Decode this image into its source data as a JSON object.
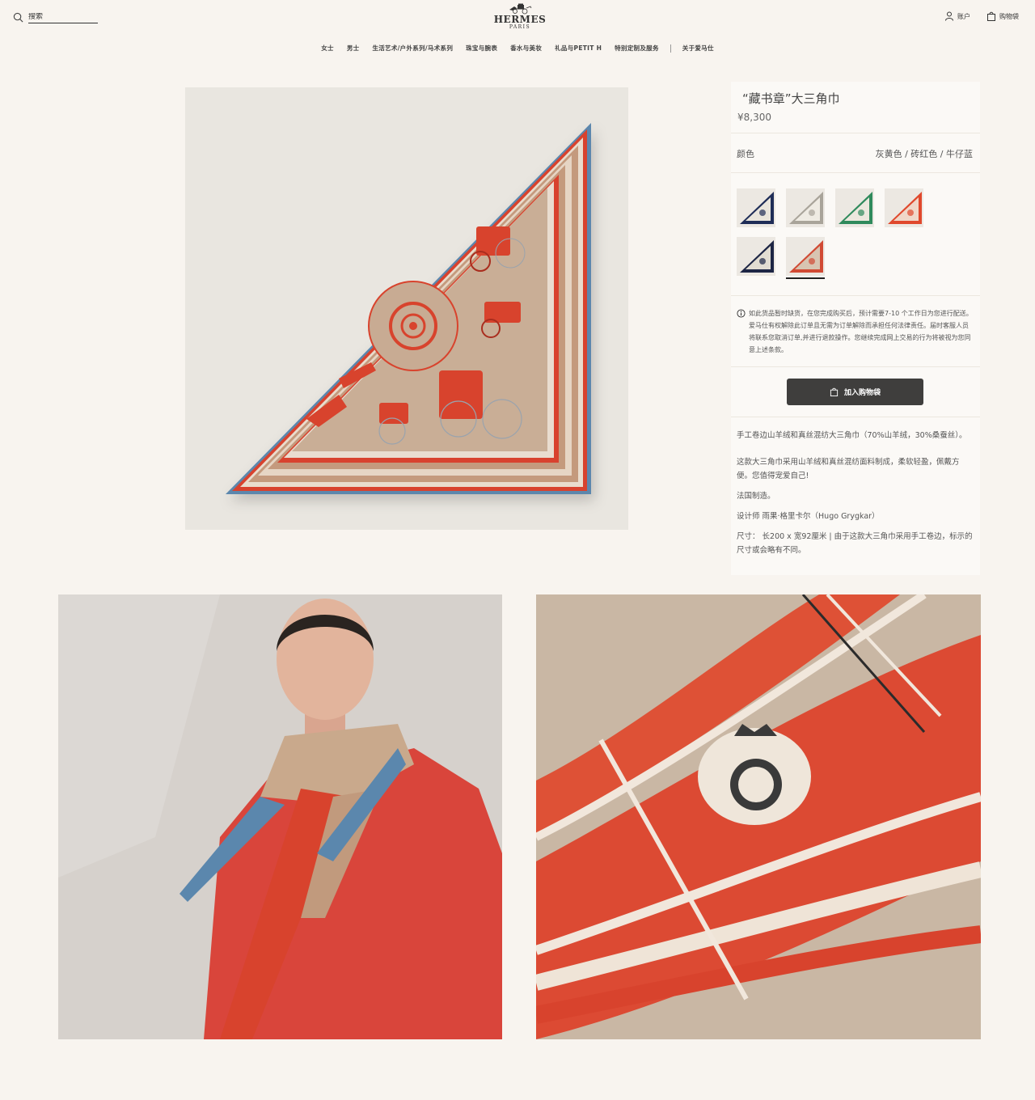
{
  "header": {
    "search_placeholder": "搜索",
    "logo_brand": "HERMES",
    "logo_city": "PARIS",
    "account_label": "账户",
    "cart_label": "购物袋"
  },
  "nav": {
    "items": [
      "女士",
      "男士",
      "生活艺术/户外系列/马术系列",
      "珠宝与腕表",
      "香水与美妆",
      "礼品与PETIT H",
      "特别定制及服务",
      "关于爱马仕"
    ]
  },
  "product": {
    "title": "“藏书章”大三角巾",
    "price": "¥8,300",
    "color_label": "颜色",
    "color_value": "灰黄色 / 砖红色 / 牛仔蓝",
    "swatches": [
      {
        "name": "navy",
        "border": "#1f2d57",
        "inner": "#e9e5dc"
      },
      {
        "name": "grey",
        "border": "#a9a49a",
        "inner": "#efebe3"
      },
      {
        "name": "green",
        "border": "#2f8a5c",
        "inner": "#ece8de"
      },
      {
        "name": "orange",
        "border": "#e0482c",
        "inner": "#f0d7c8"
      },
      {
        "name": "dark-navy",
        "border": "#1d2544",
        "inner": "#e2ddd2"
      },
      {
        "name": "beige-red",
        "border": "#d14a34",
        "inner": "#d8c4b1",
        "selected": true
      }
    ],
    "notice": "如此货品暂时缺货，在您完成购买后，预计需要7-10 个工作日为您进行配送。爱马仕有权解除此订单且无需为订单解除而承担任何法律责任。届时客服人员将联系您取消订单,并进行退款操作。您继续完成网上交易的行为将被视为您同意上述条款。",
    "add_to_cart": "加入购物袋",
    "description": [
      "手工卷边山羊绒和真丝混纺大三角巾（70%山羊绒，30%桑蚕丝）。",
      "这款大三角巾采用山羊绒和真丝混纺面料制成，柔软轻盈，佩戴方便。您值得宠爱自己!",
      "法国制造。",
      "设计师 雨果·格里卡尔（Hugo Grygkar）",
      "尺寸： 长200 x 宽92厘米 | 由于这款大三角巾采用手工卷边，标示的尺寸或会略有不同。"
    ]
  },
  "colors": {
    "background": "#f8f4ef",
    "button": "#3f3e3d",
    "scarf_red": "#d8432d",
    "scarf_beige": "#c9b09a",
    "scarf_blue": "#5b87ad"
  }
}
